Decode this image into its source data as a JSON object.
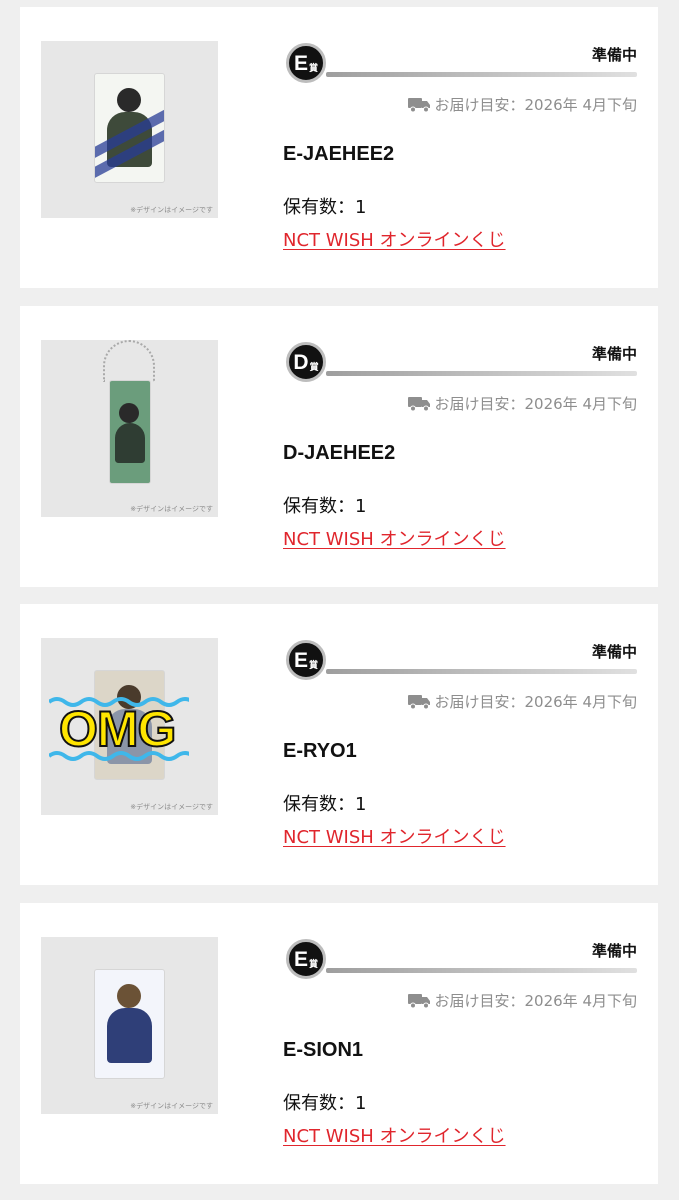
{
  "items": [
    {
      "grade_letter": "E",
      "grade_suffix": "賞",
      "status": "準備中",
      "delivery": "お届け目安：2026年 4月下旬",
      "name": "E-JAEHEE2",
      "quantity": "保有数：1",
      "link": "NCT WISH オンラインくじ",
      "image_note": "※デザインはイメージです",
      "image_kind": "photo-card"
    },
    {
      "grade_letter": "D",
      "grade_suffix": "賞",
      "status": "準備中",
      "delivery": "お届け目安：2026年 4月下旬",
      "name": "D-JAEHEE2",
      "quantity": "保有数：1",
      "link": "NCT WISH オンラインくじ",
      "image_note": "※デザインはイメージです",
      "image_kind": "keychain"
    },
    {
      "grade_letter": "E",
      "grade_suffix": "賞",
      "status": "準備中",
      "delivery": "お届け目安：2026年 4月下旬",
      "name": "E-RYO1",
      "quantity": "保有数：1",
      "link": "NCT WISH オンラインくじ",
      "image_note": "※デザインはイメージです",
      "image_kind": "photo-card-omg",
      "overlay_text": "OMG"
    },
    {
      "grade_letter": "E",
      "grade_suffix": "賞",
      "status": "準備中",
      "delivery": "お届け目安：2026年 4月下旬",
      "name": "E-SION1",
      "quantity": "保有数：1",
      "link": "NCT WISH オンラインくじ",
      "image_note": "※デザインはイメージです",
      "image_kind": "photo-card"
    }
  ],
  "icons": {
    "truck": "truck-icon"
  },
  "colors": {
    "link": "#e0262d",
    "badge": "#111111",
    "muted": "#8e8e8e"
  }
}
